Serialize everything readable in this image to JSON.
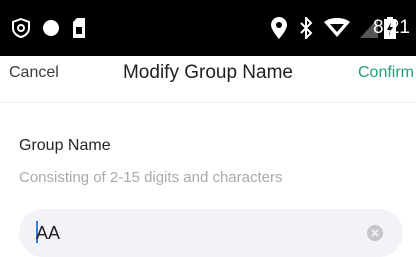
{
  "status_bar": {
    "time": "8:21",
    "icons": [
      "vpn-shield-icon",
      "record-dot-icon",
      "sim-card-icon",
      "location-pin-icon",
      "bluetooth-icon",
      "wifi-icon",
      "signal-icon",
      "battery-icon"
    ]
  },
  "nav": {
    "cancel_label": "Cancel",
    "title": "Modify Group Name",
    "confirm_label": "Confirm"
  },
  "form": {
    "label": "Group Name",
    "hint": "Consisting of 2-15 digits and characters",
    "value": "AA"
  },
  "colors": {
    "accent": "#1f9f7e",
    "input_bg": "#f2f3f7",
    "hint": "#a9a9a9"
  }
}
